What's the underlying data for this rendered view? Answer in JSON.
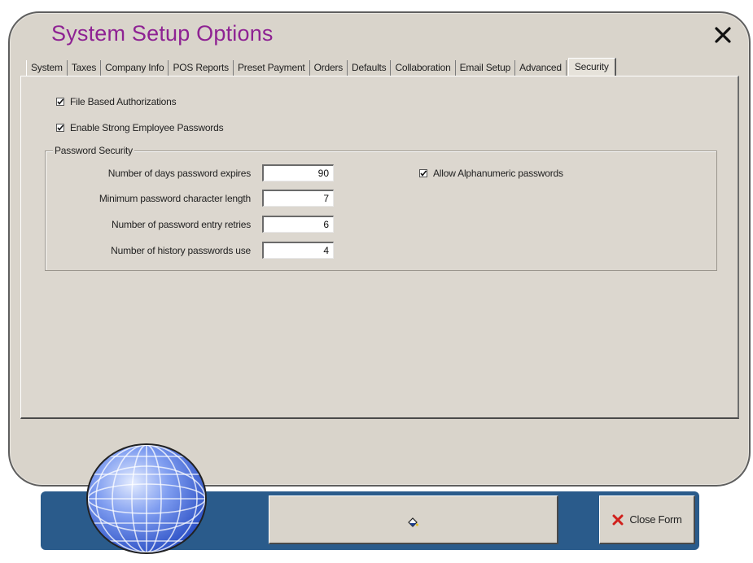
{
  "window": {
    "title": "System Setup Options"
  },
  "tabs": [
    {
      "label": "System"
    },
    {
      "label": "Taxes"
    },
    {
      "label": "Company Info"
    },
    {
      "label": "POS Reports"
    },
    {
      "label": "Preset Payment"
    },
    {
      "label": "Orders"
    },
    {
      "label": "Defaults"
    },
    {
      "label": "Collaboration"
    },
    {
      "label": "Email Setup"
    },
    {
      "label": "Advanced"
    },
    {
      "label": "Security",
      "active": true
    }
  ],
  "security": {
    "file_based_auth": {
      "label": "File Based Authorizations",
      "checked": true
    },
    "strong_passwords": {
      "label": "Enable Strong Employee Passwords",
      "checked": true
    },
    "group_title": "Password Security",
    "fields": [
      {
        "label": "Number of days password expires",
        "value": "90"
      },
      {
        "label": "Minimum password character length",
        "value": "7"
      },
      {
        "label": "Number of password entry retries",
        "value": "6"
      },
      {
        "label": "Number of history passwords use",
        "value": "4"
      }
    ],
    "alphanumeric": {
      "label": "Allow Alphanumeric passwords",
      "checked": true
    }
  },
  "footer": {
    "close_label": "Close Form"
  },
  "icons": {
    "close": "close-icon",
    "close_form": "red-x-icon",
    "footer_action": "paint-bucket-icon",
    "logo": "globe-icon"
  },
  "colors": {
    "title": "#8e2293",
    "footer_bar": "#2a5b8b",
    "window_bg": "#d9d4cb",
    "close_form_x": "#d0201c"
  }
}
